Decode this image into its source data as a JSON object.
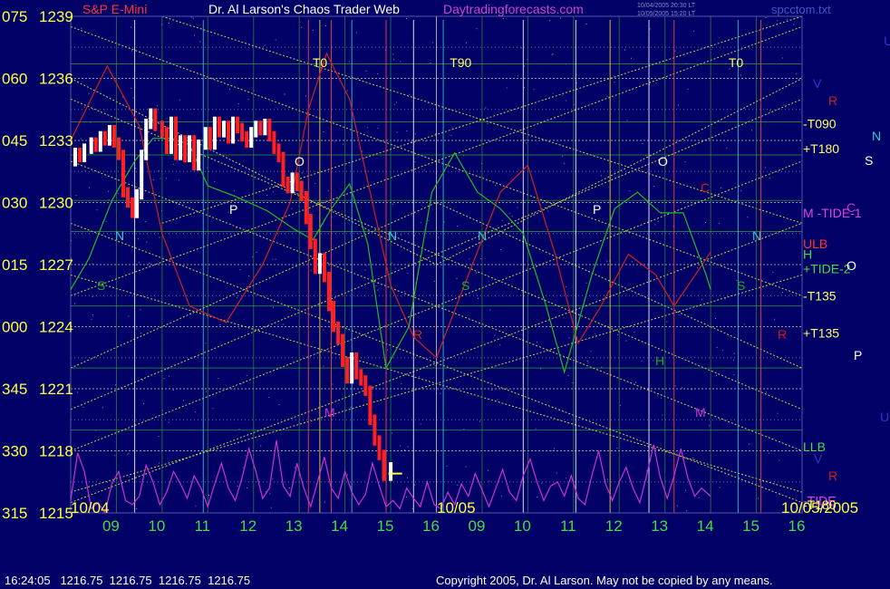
{
  "header": {
    "symbol": "S&P E-Mini",
    "title": "Dr. Al Larson's Chaos Trader Web",
    "site": "Daytradingforecasts.com",
    "stamp_line1": "10/04/2005 20:30 LT",
    "stamp_line2": "10/05/2005 15:20 LT",
    "file": "spcctom.txt"
  },
  "footer": {
    "quote": "16:24:05   1216.75  1216.75  1216.75  1216.75",
    "copyright": "Copyright 2005, Dr. Al Larson. May not be copied by any means."
  },
  "colors": {
    "background": "#000066",
    "price_up": "#ffffff",
    "price_down": "#ff2020",
    "red_cycle": "#cc2020",
    "green_cycle": "#22bb22",
    "magenta_cycle": "#cc33cc",
    "yellow_grid": "#cccc44",
    "date_label": "#ffff44",
    "hour_label": "#44dd44"
  },
  "chart_data": {
    "type": "line",
    "title": "S&P E-Mini",
    "ylim": [
      1215,
      1239
    ],
    "y_price_ticks": [
      "1239",
      "1236",
      "1233",
      "1230",
      "1227",
      "1224",
      "1221",
      "1218",
      "1215"
    ],
    "y_angle_ticks": [
      "075",
      "060",
      "045",
      "030",
      "015",
      "000",
      "345",
      "330",
      "315"
    ],
    "date_labels": [
      "10/04",
      "10/05",
      "10/05/2005"
    ],
    "x_hour_ticks": [
      "09",
      "10",
      "11",
      "12",
      "13",
      "14",
      "15",
      "16",
      "09",
      "10",
      "11",
      "12",
      "13",
      "14",
      "15",
      "16"
    ],
    "time_markers": [
      "T0",
      "T90",
      "T0"
    ],
    "right_labels": [
      {
        "text": "-T090",
        "price": 1233.8,
        "color": "#ffff66"
      },
      {
        "text": "+T180",
        "price": 1232.6,
        "color": "#ffff66"
      },
      {
        "text": "M -TIDE-1",
        "price": 1229.5,
        "color": "#dd44dd"
      },
      {
        "text": "ULB",
        "price": 1228.0,
        "color": "#ff3333"
      },
      {
        "text": "H",
        "price": 1227.5,
        "color": "#44dd44"
      },
      {
        "text": "+TIDE-2",
        "price": 1226.8,
        "color": "#44dd44"
      },
      {
        "text": "-T135",
        "price": 1225.5,
        "color": "#ffff66"
      },
      {
        "text": "+T135",
        "price": 1223.7,
        "color": "#ffff66"
      },
      {
        "text": "LLB",
        "price": 1218.2,
        "color": "#44dd44"
      },
      {
        "text": "-TIDE",
        "price": 1215.6,
        "color": "#dd44dd"
      },
      {
        "text": "-T180",
        "price": 1215.4,
        "color": "#ffff66"
      }
    ],
    "planet_glyphs": [
      {
        "text": "U",
        "x": 975,
        "y": 50,
        "color": "#3333cc"
      },
      {
        "text": "V",
        "x": 897,
        "y": 97,
        "color": "#3333cc"
      },
      {
        "text": "R",
        "x": 914,
        "y": 116,
        "color": "#cc2020"
      },
      {
        "text": "N",
        "x": 962,
        "y": 155,
        "color": "#33cccc"
      },
      {
        "text": "S",
        "x": 954,
        "y": 182,
        "color": "#ffffff"
      },
      {
        "text": "C",
        "x": 934,
        "y": 234,
        "color": "#cc33cc"
      },
      {
        "text": "O",
        "x": 934,
        "y": 298,
        "color": "#ffffff"
      },
      {
        "text": "P",
        "x": 942,
        "y": 397,
        "color": "#ffffff"
      },
      {
        "text": "U",
        "x": 971,
        "y": 465,
        "color": "#3333cc"
      },
      {
        "text": "V",
        "x": 898,
        "y": 511,
        "color": "#3333cc"
      },
      {
        "text": "R",
        "x": 914,
        "y": 530,
        "color": "#cc2020"
      },
      {
        "text": "N",
        "x": 127,
        "y": 265,
        "color": "#33cccc"
      },
      {
        "text": "S",
        "x": 107,
        "y": 320,
        "color": "#22aa22"
      },
      {
        "text": "P",
        "x": 253,
        "y": 236,
        "color": "#ffffff"
      },
      {
        "text": "O",
        "x": 325,
        "y": 183,
        "color": "#ffffff"
      },
      {
        "text": "N",
        "x": 428,
        "y": 265,
        "color": "#33cccc"
      },
      {
        "text": "R",
        "x": 456,
        "y": 374,
        "color": "#cc2020"
      },
      {
        "text": "M",
        "x": 358,
        "y": 460,
        "color": "#cc33cc"
      },
      {
        "text": "S",
        "x": 509,
        "y": 320,
        "color": "#22aa22"
      },
      {
        "text": "N",
        "x": 527,
        "y": 265,
        "color": "#33cccc"
      },
      {
        "text": "P",
        "x": 654,
        "y": 236,
        "color": "#ffffff"
      },
      {
        "text": "O",
        "x": 726,
        "y": 183,
        "color": "#ffffff"
      },
      {
        "text": "C",
        "x": 773,
        "y": 212,
        "color": "#cc2020"
      },
      {
        "text": "N",
        "x": 830,
        "y": 265,
        "color": "#33cccc"
      },
      {
        "text": "S",
        "x": 813,
        "y": 320,
        "color": "#22aa22"
      },
      {
        "text": "H",
        "x": 723,
        "y": 403,
        "color": "#22aa22"
      },
      {
        "text": "M",
        "x": 767,
        "y": 460,
        "color": "#cc33cc"
      },
      {
        "text": "R",
        "x": 858,
        "y": 374,
        "color": "#cc2020"
      }
    ],
    "series": [
      {
        "name": "S&P E-Mini",
        "color": "#ffffff",
        "points": [
          [
            0.0,
            1232.0
          ],
          [
            0.1,
            1232.4
          ],
          [
            0.2,
            1232.2
          ],
          [
            0.3,
            1232.6
          ],
          [
            0.45,
            1232.9
          ],
          [
            0.55,
            1232.7
          ],
          [
            0.65,
            1233.2
          ],
          [
            0.75,
            1233.0
          ],
          [
            0.85,
            1233.5
          ],
          [
            0.95,
            1232.9
          ],
          [
            1.05,
            1232.3
          ],
          [
            1.15,
            1230.5
          ],
          [
            1.25,
            1230.0
          ],
          [
            1.35,
            1229.5
          ],
          [
            1.45,
            1230.4
          ],
          [
            1.55,
            1232.3
          ],
          [
            1.65,
            1233.8
          ],
          [
            1.75,
            1234.3
          ],
          [
            1.85,
            1233.7
          ],
          [
            2.0,
            1233.4
          ],
          [
            2.1,
            1232.6
          ],
          [
            2.2,
            1233.9
          ],
          [
            2.3,
            1232.3
          ],
          [
            2.4,
            1233.0
          ],
          [
            2.5,
            1232.2
          ],
          [
            2.6,
            1233.0
          ],
          [
            2.7,
            1231.8
          ],
          [
            2.8,
            1232.8
          ],
          [
            2.95,
            1233.4
          ],
          [
            3.05,
            1232.8
          ],
          [
            3.15,
            1233.9
          ],
          [
            3.25,
            1233.4
          ],
          [
            3.35,
            1233.7
          ],
          [
            3.45,
            1233.1
          ],
          [
            3.55,
            1233.9
          ],
          [
            3.65,
            1233.6
          ],
          [
            3.75,
            1233.2
          ],
          [
            3.85,
            1232.9
          ],
          [
            3.95,
            1233.4
          ],
          [
            4.05,
            1233.7
          ],
          [
            4.15,
            1233.5
          ],
          [
            4.25,
            1233.8
          ],
          [
            4.35,
            1233.2
          ],
          [
            4.45,
            1232.6
          ],
          [
            4.55,
            1232.2
          ],
          [
            4.65,
            1231.0
          ],
          [
            4.75,
            1230.7
          ],
          [
            4.85,
            1231.2
          ],
          [
            4.95,
            1230.8
          ],
          [
            5.05,
            1230.3
          ],
          [
            5.15,
            1229.2
          ],
          [
            5.25,
            1228.0
          ],
          [
            5.35,
            1226.8
          ],
          [
            5.45,
            1227.3
          ],
          [
            5.55,
            1226.4
          ],
          [
            5.65,
            1225.0
          ],
          [
            5.75,
            1224.0
          ],
          [
            5.85,
            1223.4
          ],
          [
            5.95,
            1222.3
          ],
          [
            6.05,
            1221.5
          ],
          [
            6.15,
            1222.5
          ],
          [
            6.25,
            1221.7
          ],
          [
            6.35,
            1221.4
          ],
          [
            6.45,
            1220.9
          ],
          [
            6.55,
            1219.5
          ],
          [
            6.65,
            1218.5
          ],
          [
            6.75,
            1217.8
          ],
          [
            6.85,
            1216.8
          ],
          [
            7.0,
            1217.2
          ]
        ]
      },
      {
        "name": "red cycle",
        "color": "#cc2020",
        "points": [
          [
            0.0,
            1233.0
          ],
          [
            0.8,
            1236.6
          ],
          [
            1.5,
            1233.7
          ],
          [
            2.0,
            1228.5
          ],
          [
            2.6,
            1225.0
          ],
          [
            3.4,
            1224.2
          ],
          [
            4.2,
            1227.0
          ],
          [
            4.8,
            1230.0
          ],
          [
            5.2,
            1234.5
          ],
          [
            5.6,
            1237.2
          ],
          [
            6.1,
            1235.0
          ],
          [
            6.6,
            1230.0
          ],
          [
            7.0,
            1226.0
          ],
          [
            7.5,
            1223.5
          ],
          [
            8.0,
            1222.5
          ],
          [
            8.7,
            1226.5
          ],
          [
            9.4,
            1230.5
          ],
          [
            10.0,
            1231.8
          ],
          [
            10.6,
            1227.5
          ],
          [
            11.1,
            1223.2
          ],
          [
            11.6,
            1225.0
          ],
          [
            12.2,
            1227.5
          ],
          [
            12.8,
            1226.5
          ],
          [
            13.2,
            1225.0
          ],
          [
            14.0,
            1227.6
          ]
        ]
      },
      {
        "name": "green cycle",
        "color": "#22bb22",
        "points": [
          [
            0.0,
            1225.8
          ],
          [
            0.4,
            1227.3
          ],
          [
            0.9,
            1230.1
          ],
          [
            1.4,
            1232.0
          ],
          [
            1.8,
            1233.1
          ],
          [
            2.2,
            1233.1
          ],
          [
            2.6,
            1232.8
          ],
          [
            3.0,
            1230.8
          ],
          [
            3.6,
            1230.3
          ],
          [
            4.3,
            1229.6
          ],
          [
            4.9,
            1228.7
          ],
          [
            5.3,
            1228.2
          ],
          [
            5.7,
            1229.7
          ],
          [
            6.1,
            1230.9
          ],
          [
            6.5,
            1228.0
          ],
          [
            6.9,
            1222.0
          ],
          [
            7.4,
            1224.0
          ],
          [
            7.9,
            1230.5
          ],
          [
            8.4,
            1232.4
          ],
          [
            8.9,
            1230.5
          ],
          [
            9.4,
            1229.7
          ],
          [
            9.9,
            1228.5
          ],
          [
            10.4,
            1225.0
          ],
          [
            10.8,
            1221.8
          ],
          [
            11.4,
            1226.5
          ],
          [
            11.9,
            1229.7
          ],
          [
            12.4,
            1230.5
          ],
          [
            12.9,
            1229.5
          ],
          [
            13.4,
            1229.5
          ],
          [
            13.9,
            1226.5
          ],
          [
            14.0,
            1225.8
          ]
        ]
      },
      {
        "name": "magenta cycle",
        "color": "#cc33cc",
        "points": [
          [
            0.0,
            1215.6
          ],
          [
            0.15,
            1217.9
          ],
          [
            0.3,
            1217.0
          ],
          [
            0.45,
            1215.2
          ],
          [
            0.6,
            1215.5
          ],
          [
            0.75,
            1215.0
          ],
          [
            0.9,
            1216.4
          ],
          [
            1.05,
            1217.0
          ],
          [
            1.2,
            1215.6
          ],
          [
            1.35,
            1215.4
          ],
          [
            1.5,
            1215.8
          ],
          [
            1.65,
            1217.3
          ],
          [
            1.8,
            1216.5
          ],
          [
            1.95,
            1215.4
          ],
          [
            2.1,
            1216.0
          ],
          [
            2.25,
            1217.0
          ],
          [
            2.4,
            1216.4
          ],
          [
            2.55,
            1215.7
          ],
          [
            2.7,
            1216.8
          ],
          [
            2.85,
            1216.2
          ],
          [
            3.0,
            1215.3
          ],
          [
            3.15,
            1216.4
          ],
          [
            3.3,
            1217.4
          ],
          [
            3.45,
            1216.2
          ],
          [
            3.6,
            1215.6
          ],
          [
            3.75,
            1216.7
          ],
          [
            3.9,
            1218.1
          ],
          [
            4.05,
            1217.0
          ],
          [
            4.2,
            1215.7
          ],
          [
            4.35,
            1216.2
          ],
          [
            4.5,
            1218.5
          ],
          [
            4.65,
            1216.3
          ],
          [
            4.8,
            1215.8
          ],
          [
            4.95,
            1217.4
          ],
          [
            5.1,
            1216.2
          ],
          [
            5.25,
            1215.3
          ],
          [
            5.4,
            1216.5
          ],
          [
            5.55,
            1217.7
          ],
          [
            5.7,
            1216.2
          ],
          [
            5.85,
            1215.7
          ],
          [
            6.0,
            1217.0
          ],
          [
            6.15,
            1216.0
          ],
          [
            6.3,
            1215.4
          ],
          [
            6.45,
            1215.9
          ],
          [
            6.6,
            1217.4
          ],
          [
            6.75,
            1216.3
          ],
          [
            6.9,
            1215.3
          ],
          [
            7.05,
            1215.6
          ],
          [
            7.2,
            1215.2
          ],
          [
            7.35,
            1216.2
          ],
          [
            7.5,
            1215.7
          ],
          [
            7.65,
            1215.3
          ],
          [
            7.8,
            1216.5
          ],
          [
            7.95,
            1215.4
          ],
          [
            8.1,
            1215.2
          ],
          [
            8.25,
            1216.0
          ],
          [
            8.4,
            1215.4
          ],
          [
            8.55,
            1216.4
          ],
          [
            8.7,
            1215.8
          ],
          [
            8.85,
            1216.9
          ],
          [
            9.0,
            1216.1
          ],
          [
            9.15,
            1215.3
          ],
          [
            9.3,
            1216.2
          ],
          [
            9.45,
            1217.1
          ],
          [
            9.6,
            1216.0
          ],
          [
            9.75,
            1215.6
          ],
          [
            9.9,
            1216.8
          ],
          [
            10.05,
            1217.6
          ],
          [
            10.2,
            1216.5
          ],
          [
            10.35,
            1215.6
          ],
          [
            10.5,
            1216.3
          ],
          [
            10.65,
            1216.5
          ],
          [
            10.8,
            1215.8
          ],
          [
            10.95,
            1216.8
          ],
          [
            11.1,
            1215.7
          ],
          [
            11.25,
            1215.4
          ],
          [
            11.4,
            1216.8
          ],
          [
            11.55,
            1218.0
          ],
          [
            11.7,
            1216.4
          ],
          [
            11.85,
            1215.6
          ],
          [
            12.0,
            1216.5
          ],
          [
            12.15,
            1217.2
          ],
          [
            12.3,
            1216.2
          ],
          [
            12.45,
            1215.5
          ],
          [
            12.6,
            1216.8
          ],
          [
            12.75,
            1218.3
          ],
          [
            12.9,
            1216.7
          ],
          [
            13.05,
            1215.7
          ],
          [
            13.2,
            1216.8
          ],
          [
            13.35,
            1218.1
          ],
          [
            13.5,
            1216.7
          ],
          [
            13.65,
            1215.8
          ],
          [
            13.8,
            1216.2
          ],
          [
            14.0,
            1215.8
          ]
        ]
      }
    ],
    "grid": true,
    "legend": "none"
  }
}
